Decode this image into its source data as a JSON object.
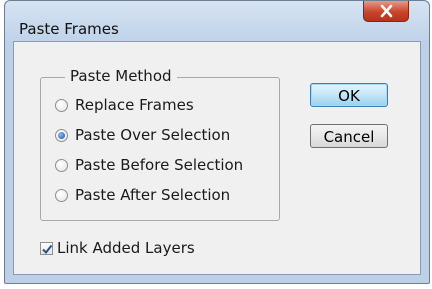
{
  "dialog": {
    "title": "Paste Frames",
    "close_icon": "close-icon"
  },
  "paste_method": {
    "legend": "Paste Method",
    "options": [
      {
        "label": "Replace Frames",
        "checked": false
      },
      {
        "label": "Paste Over Selection",
        "checked": true
      },
      {
        "label": "Paste Before Selection",
        "checked": false
      },
      {
        "label": "Paste After Selection",
        "checked": false
      }
    ]
  },
  "buttons": {
    "ok": "OK",
    "cancel": "Cancel"
  },
  "link_added_layers": {
    "label": "Link Added Layers",
    "checked": true
  },
  "colors": {
    "frame": "#bdd0e6",
    "close_button": "#c8442b",
    "radio_dot": "#1c53a5"
  }
}
